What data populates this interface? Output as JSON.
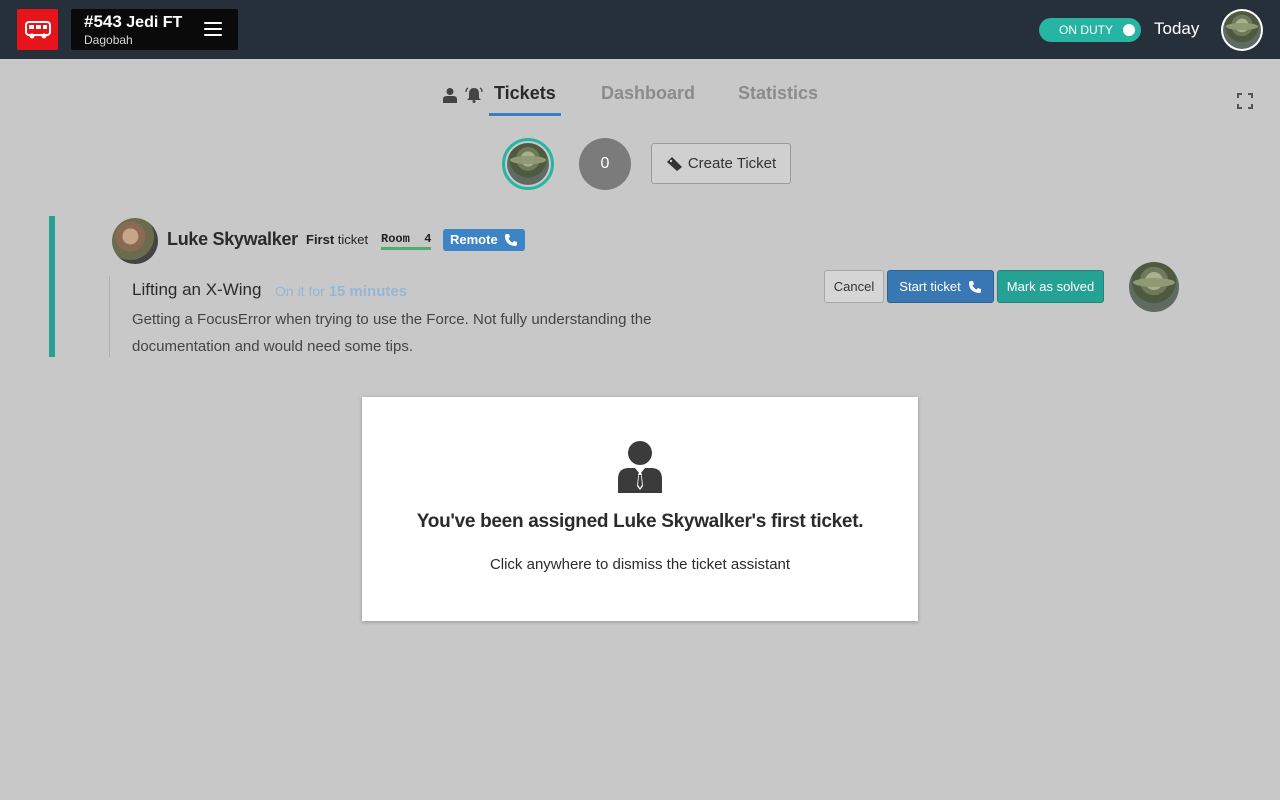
{
  "header": {
    "logo_icon": "bus-icon",
    "course_number": "#543",
    "course_name": "Jedi FT",
    "location": "Dagobah",
    "duty_label": "ON DUTY",
    "duty_on": true,
    "today_label": "Today"
  },
  "tabs": [
    {
      "label": "Tickets",
      "active": true
    },
    {
      "label": "Dashboard",
      "active": false
    },
    {
      "label": "Statistics",
      "active": false
    }
  ],
  "queue": {
    "count": "0",
    "create_label": "Create Ticket"
  },
  "ticket": {
    "student_name": "Luke Skywalker",
    "first_word": "First",
    "ticket_word": "ticket",
    "room_label": "Room",
    "room_number": "4",
    "remote_label": "Remote",
    "subject": "Lifting an X-Wing",
    "since_prefix": "On it for",
    "since_value": "15 minutes",
    "description": "Getting a FocusError when trying to use the Force. Not fully understanding the documentation and would need some tips.",
    "cancel_label": "Cancel",
    "start_label": "Start ticket",
    "solved_label": "Mark as solved"
  },
  "modal": {
    "title": "You've been assigned Luke Skywalker's first ticket.",
    "subtitle": "Click anywhere to dismiss the ticket assistant"
  },
  "colors": {
    "topbar": "#26303b",
    "brand_red": "#e8141c",
    "teal": "#26b5a3",
    "blue": "#3a78b3"
  }
}
